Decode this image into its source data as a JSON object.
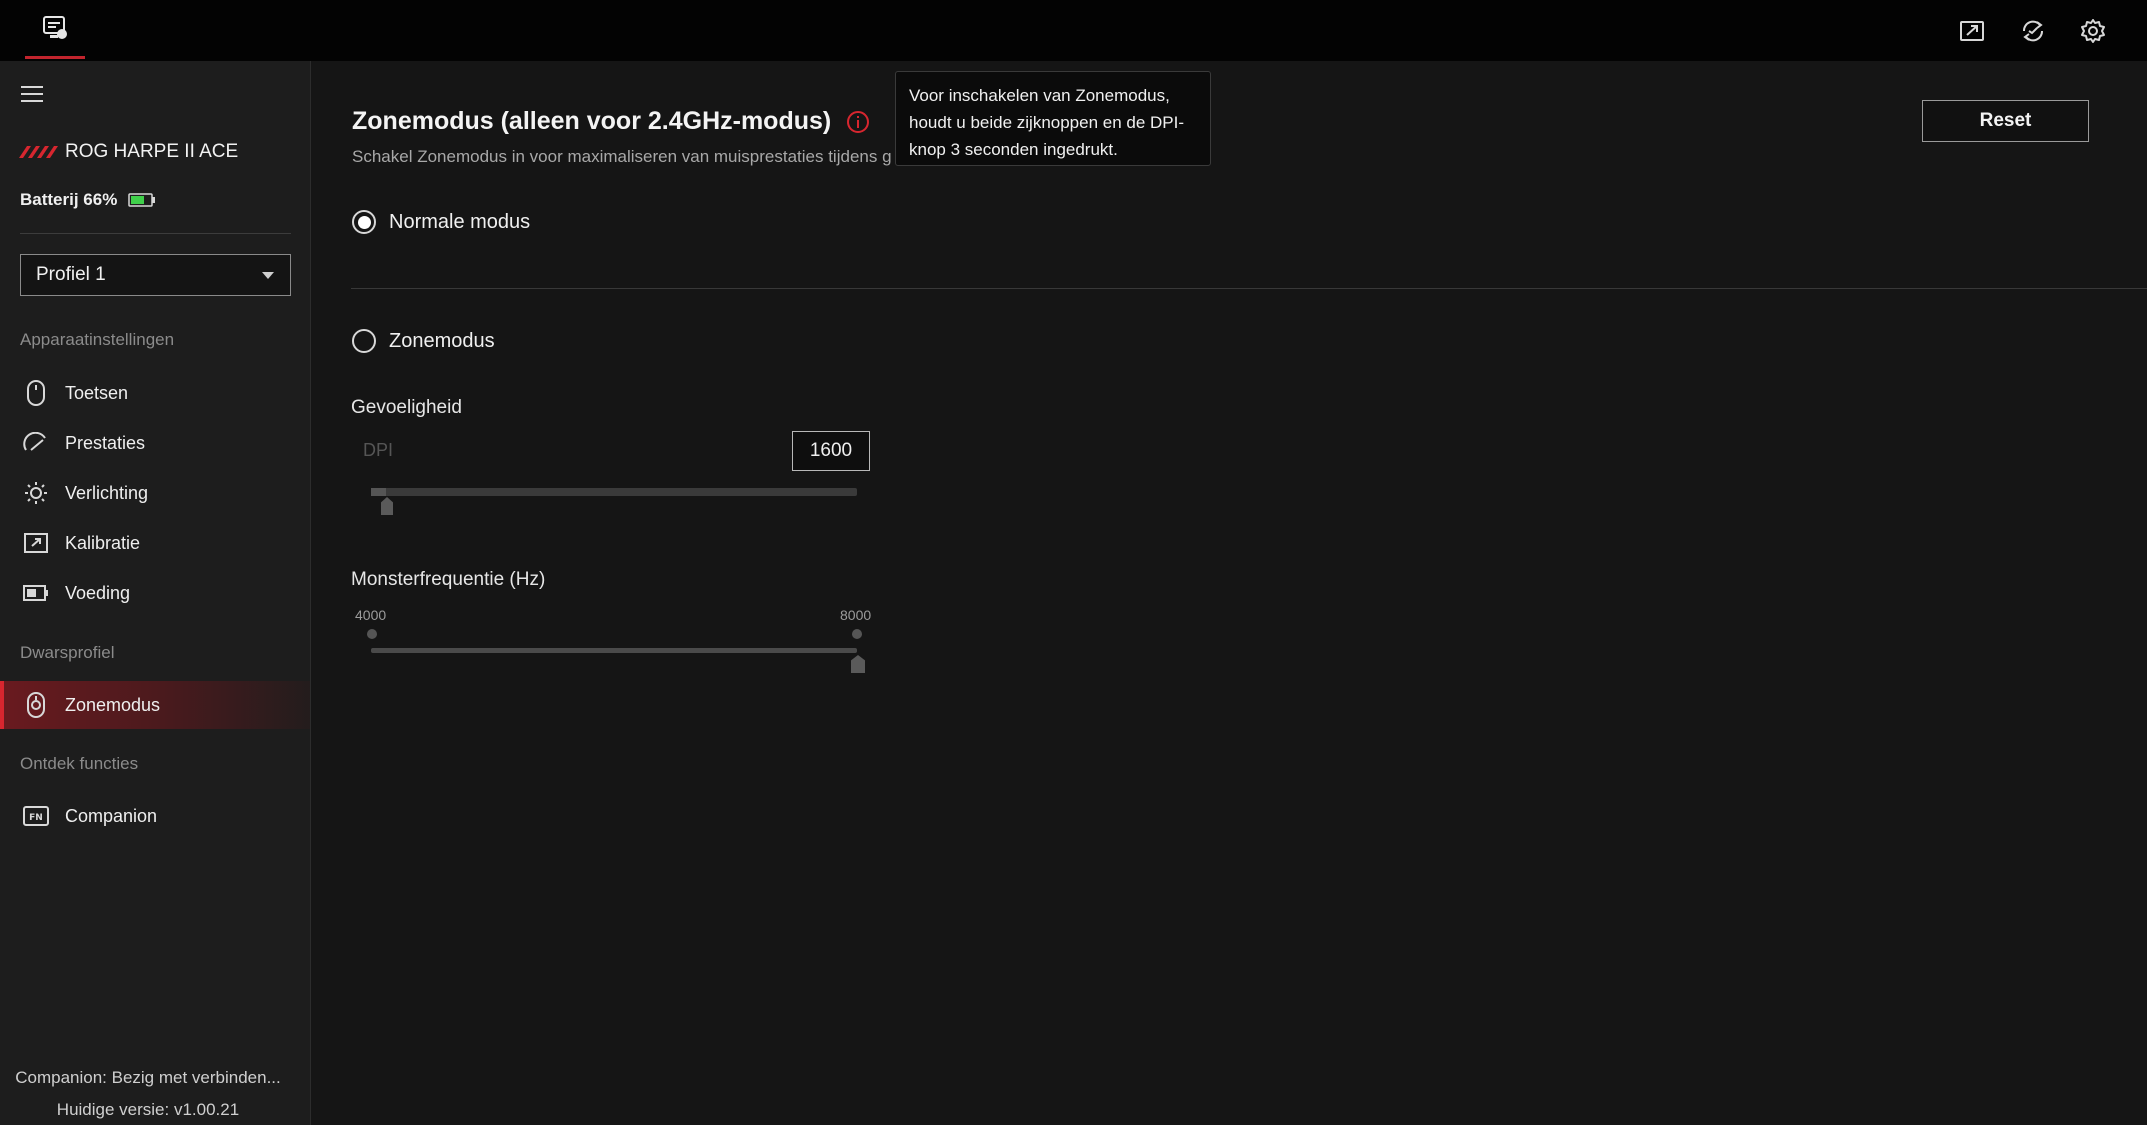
{
  "topbar": {
    "icons": [
      "device-icon",
      "export-icon",
      "sync-icon",
      "settings-gear-icon"
    ]
  },
  "sidebar": {
    "menu_icon": "hamburger-menu-icon",
    "device_name": "ROG HARPE II ACE",
    "battery_label": "Batterij 66%",
    "battery_level": 0.66,
    "profile": "Profiel 1",
    "section_device": "Apparaatinstellingen",
    "items": [
      {
        "label": "Toetsen",
        "icon": "mouse-icon"
      },
      {
        "label": "Prestaties",
        "icon": "performance-icon"
      },
      {
        "label": "Verlichting",
        "icon": "lighting-icon"
      },
      {
        "label": "Kalibratie",
        "icon": "calibration-icon"
      },
      {
        "label": "Voeding",
        "icon": "battery-icon"
      }
    ],
    "section_cross": "Dwarsprofiel",
    "zone_item": {
      "label": "Zonemodus",
      "icon": "zone-mode-icon"
    },
    "section_discover": "Ontdek functies",
    "companion_item": {
      "label": "Companion",
      "icon": "fn-key-icon"
    },
    "footer_status": "Companion: Bezig met verbinden...",
    "footer_version": "Huidige versie: v1.00.21"
  },
  "main": {
    "title": "Zonemodus (alleen voor 2.4GHz-modus)",
    "subtitle": "Schakel Zonemodus in voor maximaliseren van muisprestaties tijdens g",
    "tooltip": "Voor inschakelen van Zonemodus, houdt u beide zijknoppen en de DPI-knop 3 seconden ingedrukt.",
    "reset_label": "Reset",
    "mode_normal": "Normale modus",
    "mode_zone": "Zonemodus",
    "selected_mode": "Normale modus",
    "sensitivity_label": "Gevoeligheid",
    "dpi_label": "DPI",
    "dpi_value": "1600",
    "dpi_slider_fraction": 0.03,
    "frequency_label": "Monsterfrequentie (Hz)",
    "freq_min": "4000",
    "freq_max": "8000",
    "freq_value": 8000
  },
  "colors": {
    "accent": "#d7262f",
    "battery_green": "#3fcf4a",
    "background": "#151515",
    "sidebar": "#1d1d1d"
  }
}
